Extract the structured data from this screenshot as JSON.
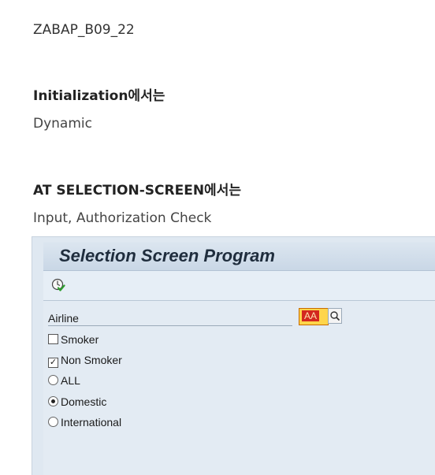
{
  "doc": {
    "program_name": "ZABAP_B09_22",
    "heading_initialization": "Initialization에서는",
    "initialization_text": "Dynamic",
    "heading_at_selection": "AT SELECTION-SCREEN에서는",
    "at_selection_text": "Input, Authorization Check"
  },
  "sap": {
    "title": "Selection Screen Program",
    "execute_icon": "execute-icon",
    "airline_label": "Airline",
    "airline_value": "AA",
    "search_icon": "search-help-icon",
    "checkboxes": [
      {
        "label": "Smoker",
        "checked": false
      },
      {
        "label": "Non Smoker",
        "checked": true
      }
    ],
    "radios": [
      {
        "label": "ALL",
        "selected": false
      },
      {
        "label": "Domestic",
        "selected": true
      },
      {
        "label": "International",
        "selected": false
      }
    ]
  }
}
